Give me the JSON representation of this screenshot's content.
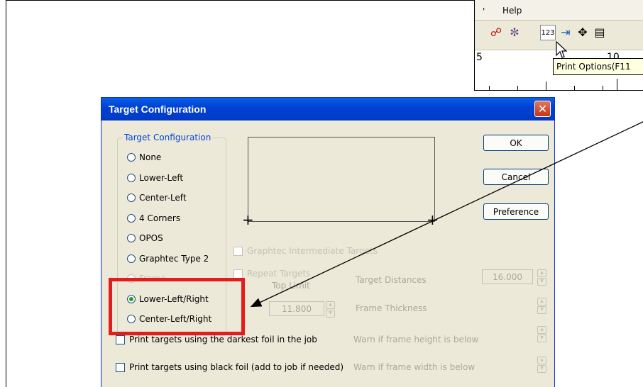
{
  "app": {
    "menu": {
      "separator": "'",
      "help": "Help"
    },
    "toolbar_icons": [
      "print-icon",
      "color-icon",
      "print-options-icon",
      "import-icon",
      "move-icon",
      "panel-icon"
    ],
    "ruler_numbers": [
      "5",
      "10"
    ],
    "tooltip": "Print Options(F11"
  },
  "dialog": {
    "title": "Target Configuration",
    "close": "✕",
    "group_label": "Target Configuration",
    "options": [
      {
        "label": "None",
        "selected": false,
        "enabled": true
      },
      {
        "label": "Lower-Left",
        "selected": false,
        "enabled": true
      },
      {
        "label": "Center-Left",
        "selected": false,
        "enabled": true
      },
      {
        "label": "4 Corners",
        "selected": false,
        "enabled": true
      },
      {
        "label": "OPOS",
        "selected": false,
        "enabled": true
      },
      {
        "label": "Graphtec Type 2",
        "selected": false,
        "enabled": true
      },
      {
        "label": "Frame",
        "selected": false,
        "enabled": false
      },
      {
        "label": "Lower-Left/Right",
        "selected": true,
        "enabled": true
      },
      {
        "label": "Center-Left/Right",
        "selected": false,
        "enabled": true
      }
    ],
    "buttons": {
      "ok": "OK",
      "cancel": "Cancel",
      "preference": "Preference"
    },
    "graphtec_intermediate": "Graphtec Intermediate Targets",
    "repeat_targets": "Repeat Targets",
    "top_limit_label": "Top Limit",
    "top_limit_value": "11.800",
    "target_distances_label": "Target Distances",
    "target_distances_value": "16.000",
    "frame_thickness_label": "Frame Thickness",
    "warn_height_label": "Warn if frame height is below",
    "warn_width_label": "Warn if frame width is below",
    "darkest_foil": "Print targets using the darkest foil in the job",
    "black_foil": "Print targets using black foil (add to job if needed)"
  },
  "annotation": {
    "highlight_color": "#e41c1c"
  }
}
